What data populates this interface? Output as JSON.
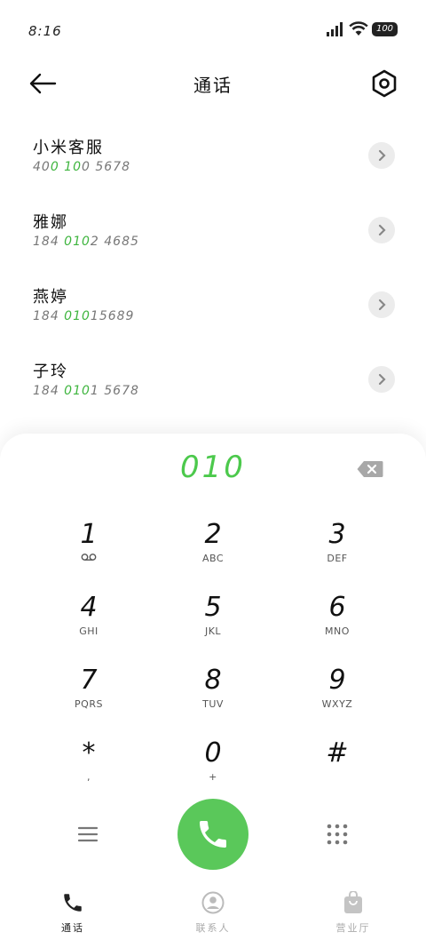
{
  "status_bar": {
    "time": "8:16",
    "battery": "100"
  },
  "header": {
    "title": "通话"
  },
  "recents": [
    {
      "name": "小米客服",
      "num_pre": "40",
      "num_hl": "0 10",
      "num_post": "0 5678"
    },
    {
      "name": "雅娜",
      "num_pre": "184 ",
      "num_hl": "010",
      "num_post": "2 4685"
    },
    {
      "name": "燕婷",
      "num_pre": "184 ",
      "num_hl": "010",
      "num_post": "15689"
    },
    {
      "name": "子玲",
      "num_pre": "184 ",
      "num_hl": "010",
      "num_post": "1 5678"
    }
  ],
  "dialer": {
    "input": "010",
    "keys": [
      {
        "digit": "1",
        "sub": ""
      },
      {
        "digit": "2",
        "sub": "ABC"
      },
      {
        "digit": "3",
        "sub": "DEF"
      },
      {
        "digit": "4",
        "sub": "GHI"
      },
      {
        "digit": "5",
        "sub": "JKL"
      },
      {
        "digit": "6",
        "sub": "MNO"
      },
      {
        "digit": "7",
        "sub": "PQRS"
      },
      {
        "digit": "8",
        "sub": "TUV"
      },
      {
        "digit": "9",
        "sub": "WXYZ"
      },
      {
        "digit": "*",
        "sub": ","
      },
      {
        "digit": "0",
        "sub": "+"
      },
      {
        "digit": "#",
        "sub": ""
      }
    ]
  },
  "tabs": [
    {
      "label": "通话",
      "icon": "phone-icon",
      "active": true
    },
    {
      "label": "联系人",
      "icon": "contacts-icon",
      "active": false
    },
    {
      "label": "营业厅",
      "icon": "store-bag-icon",
      "active": false
    }
  ],
  "colors": {
    "accent": "#5ac85a",
    "highlight": "#3fb53f"
  }
}
